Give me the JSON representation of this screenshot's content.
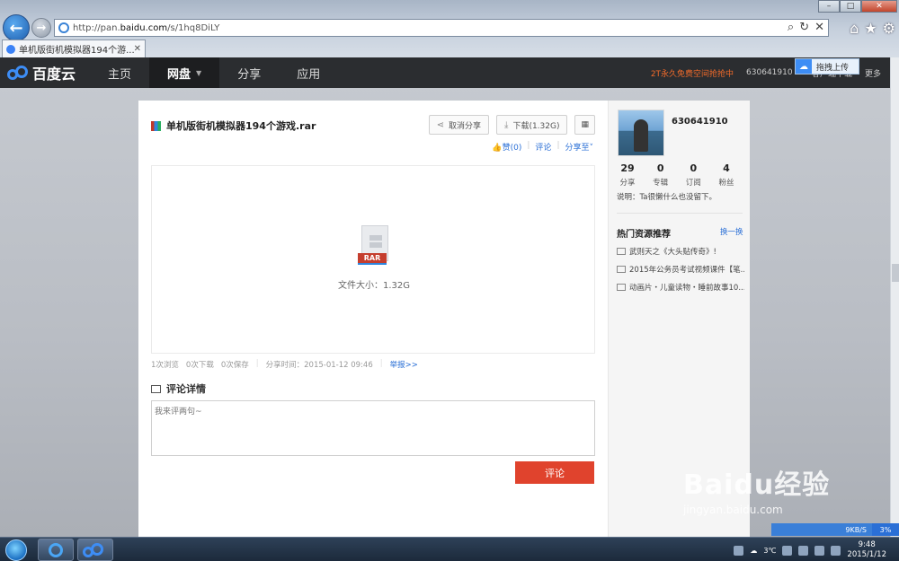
{
  "browser": {
    "url_prefix": "http://pan.",
    "url_domain": "baidu.com",
    "url_path": "/s/1hq8DiLY",
    "tab_title": "单机版街机模拟器194个游...",
    "tab_close": "✕"
  },
  "header": {
    "logo_text": "百度云",
    "nav": [
      {
        "label": "主页"
      },
      {
        "label": "网盘"
      },
      {
        "label": "分享"
      },
      {
        "label": "应用"
      }
    ],
    "promo": "2T永久免费空间抢抢中",
    "username": "630641910",
    "client_download": "客户端下载",
    "more": "更多",
    "drag_upload": "拖拽上传"
  },
  "file": {
    "name": "单机版街机模拟器194个游戏.rar",
    "cancel_share": "取消分享",
    "download": "下载(1.32G)",
    "like": "赞(0)",
    "comment": "评论",
    "share_to": "分享至",
    "type_label": "RAR",
    "size_text": "文件大小：1.32G",
    "stats": {
      "views": "1次浏览",
      "downloads": "0次下载",
      "saves": "0次保存",
      "share_time": "分享时间：2015-01-12 09:46",
      "report": "举报>>"
    }
  },
  "comments": {
    "title": "评论详情",
    "placeholder": "我来评两句~",
    "submit": "评论"
  },
  "sidebar": {
    "username": "630641910",
    "counts": [
      {
        "num": "29",
        "label": "分享"
      },
      {
        "num": "0",
        "label": "专辑"
      },
      {
        "num": "0",
        "label": "订阅"
      },
      {
        "num": "4",
        "label": "粉丝"
      }
    ],
    "description": "说明：Ta很懒什么也没留下。",
    "hot_title": "热门资源推荐",
    "hot_switch": "换一换",
    "hot_items": [
      "武则天之《大头贴传奇》!",
      "2015年公务员考试视频课件【笔...",
      "动画片・儿童读物・睡前故事10..."
    ]
  },
  "watermark": {
    "logo": "Baidu经验",
    "url": "jingyan.baidu.com"
  },
  "status_strip": {
    "speed": "9KB/S",
    "percent": "3%"
  },
  "taskbar": {
    "temp": "3℃",
    "time": "9:48",
    "date": "2015/1/12"
  }
}
